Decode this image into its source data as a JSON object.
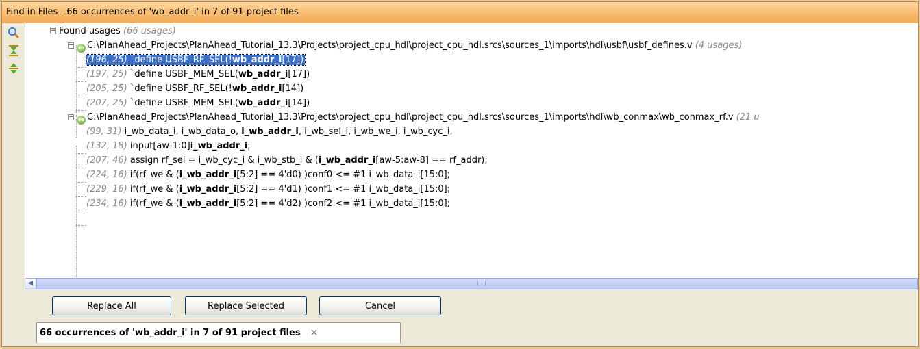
{
  "window": {
    "title": "Find in Files - 66 occurrences of 'wb_addr_i' in 7 of 91 project files"
  },
  "toolbar": {
    "icons": [
      "search-icon",
      "collapse-all-icon",
      "expand-all-icon"
    ]
  },
  "tree": {
    "root": {
      "label": "Found usages",
      "count": "(66 usages)"
    },
    "files": [
      {
        "path": "C:\\PlanAhead_Projects\\PlanAhead_Tutorial_13.3\\Projects\\project_cpu_hdl\\project_cpu_hdl.srcs\\sources_1\\imports\\hdl\\usbf\\usbf_defines.v",
        "count": "(4 usages)",
        "usages": [
          {
            "pos": "(196, 25)",
            "pre": "`define USBF_RF_SEL(!",
            "match": "wb_addr_i",
            "post": "[17])"
          },
          {
            "pos": "(197, 25)",
            "pre": "`define USBF_MEM_SEL(",
            "match": "wb_addr_i",
            "post": "[17])"
          },
          {
            "pos": "(205, 25)",
            "pre": "`define USBF_RF_SEL(!",
            "match": "wb_addr_i",
            "post": "[14])"
          },
          {
            "pos": "(207, 25)",
            "pre": "`define USBF_MEM_SEL(",
            "match": "wb_addr_i",
            "post": "[14])"
          }
        ]
      },
      {
        "path": "C:\\PlanAhead_Projects\\PlanAhead_Tutorial_13.3\\Projects\\project_cpu_hdl\\project_cpu_hdl.srcs\\sources_1\\imports\\hdl\\wb_conmax\\wb_conmax_rf.v",
        "count": "(21 u",
        "usages": [
          {
            "pos": "(99, 31)",
            "pre": "i_wb_data_i, i_wb_data_o, ",
            "match": "i_wb_addr_i",
            "post": ", i_wb_sel_i, i_wb_we_i, i_wb_cyc_i,"
          },
          {
            "pos": "(132, 18)",
            "pre": "input[aw-1:0]",
            "match": "i_wb_addr_i",
            "post": ";"
          },
          {
            "pos": "(207, 46)",
            "pre": "assign rf_sel = i_wb_cyc_i & i_wb_stb_i & (",
            "match": "i_wb_addr_i",
            "post": "[aw-5:aw-8] == rf_addr);"
          },
          {
            "pos": "(224, 16)",
            "pre": "if(rf_we & (",
            "match": "i_wb_addr_i",
            "post": "[5:2] == 4'd0) )conf0 <= #1 i_wb_data_i[15:0];"
          },
          {
            "pos": "(229, 16)",
            "pre": "if(rf_we & (",
            "match": "i_wb_addr_i",
            "post": "[5:2] == 4'd1) )conf1 <= #1 i_wb_data_i[15:0];"
          },
          {
            "pos": "(234, 16)",
            "pre": "if(rf_we & (",
            "match": "i_wb_addr_i",
            "post": "[5:2] == 4'd2) )conf2 <= #1 i_wb_data_i[15:0];"
          }
        ]
      }
    ]
  },
  "buttons": {
    "replace_all": "Replace All",
    "replace_selected": "Replace Selected",
    "cancel": "Cancel"
  },
  "bottom_tab": {
    "label": "66 occurrences of 'wb_addr_i' in 7 of 91 project files",
    "close": "×"
  },
  "colors": {
    "title_bar": "#f7ba6e",
    "selection": "#3c6fc6",
    "position_text": "#8a8a8a"
  }
}
